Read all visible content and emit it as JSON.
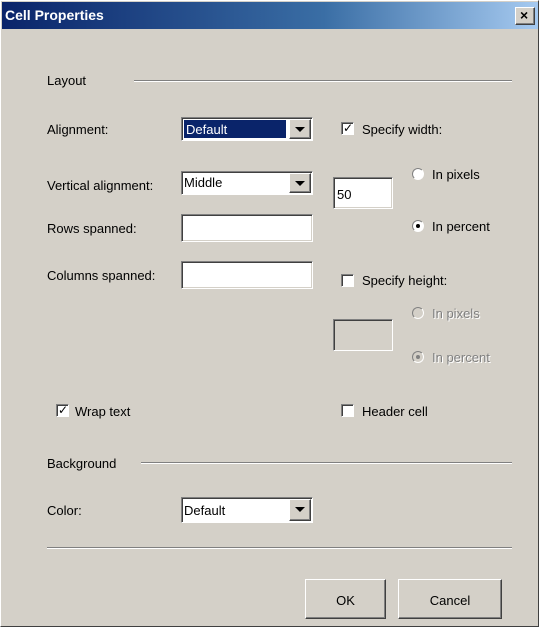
{
  "window": {
    "title": "Cell Properties",
    "close_glyph": "×"
  },
  "layout_section": {
    "header": "Layout",
    "alignment": {
      "label": "Alignment:",
      "value": "Default"
    },
    "vertical_alignment": {
      "label": "Vertical alignment:",
      "value": "Middle"
    },
    "rows_spanned": {
      "label": "Rows spanned:",
      "value": ""
    },
    "columns_spanned": {
      "label": "Columns spanned:",
      "value": ""
    },
    "specify_width": {
      "label": "Specify width:",
      "checked": true,
      "value": "50",
      "in_pixels": "In pixels",
      "in_percent": "In percent",
      "selected": "In percent"
    },
    "specify_height": {
      "label": "Specify height:",
      "checked": false,
      "value": "",
      "in_pixels": "In pixels",
      "in_percent": "In percent",
      "selected": "In percent"
    },
    "wrap_text": {
      "label": "Wrap text",
      "checked": true
    },
    "header_cell": {
      "label": "Header cell",
      "checked": false
    }
  },
  "background_section": {
    "header": "Background",
    "color": {
      "label": "Color:",
      "value": "Default"
    }
  },
  "buttons": {
    "ok": "OK",
    "cancel": "Cancel"
  },
  "icons": {
    "checkmark": "check-icon",
    "dropdown": "chevron-down-icon",
    "close": "close-icon"
  },
  "colors": {
    "titlebar_start": "#0a246a",
    "titlebar_end": "#a6caf0",
    "dialog_bg": "#d4d0c8",
    "selection": "#0a246a"
  }
}
